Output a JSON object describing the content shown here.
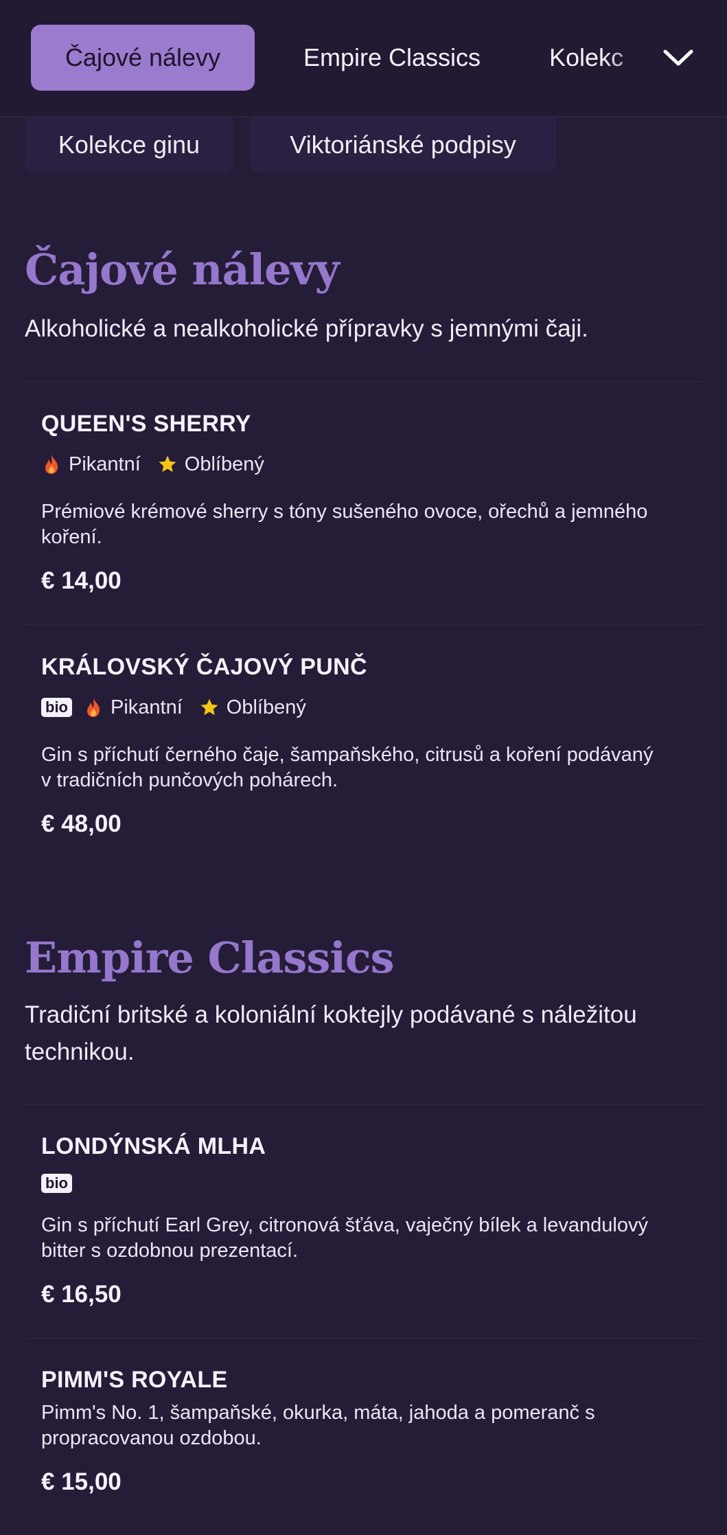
{
  "nav": {
    "tabs": [
      "Čajové nálevy",
      "Empire Classics",
      "Kolekce ginu"
    ],
    "tab_overflow_visible": "Kolekc",
    "row2": [
      "Kolekce ginu",
      "Viktoriánské podpisy"
    ],
    "active_color": "#9b7bce"
  },
  "sections": [
    {
      "title": "Čajové nálevy",
      "description": "Alkoholické a nealkoholické přípravky s jemnými čaji.",
      "items": [
        {
          "name": "QUEEN'S SHERRY",
          "tags": [
            "Pikantní",
            "Oblíbený"
          ],
          "description": "Prémiové krémové sherry s tóny sušeného ovoce, ořechů a jemného koření.",
          "price": "€ 14,00"
        },
        {
          "name": "KRÁLOVSKÝ ČAJOVÝ PUNČ",
          "badge": "bio",
          "tags": [
            "Pikantní",
            "Oblíbený"
          ],
          "description": "Gin s příchutí černého čaje, šampaňského, citrusů a koření podávaný v tradičních punčových pohárech.",
          "price": "€ 48,00"
        }
      ]
    },
    {
      "title": "Empire Classics",
      "description": "Tradiční britské a koloniální koktejly podávané s náležitou technikou.",
      "items": [
        {
          "name": "LONDÝNSKÁ MLHA",
          "badge": "bio",
          "description": "Gin s příchutí Earl Grey, citronová šťáva, vaječný bílek a levandulový bitter s ozdobnou prezentací.",
          "price": "€ 16,50"
        },
        {
          "name": "PIMM'S ROYALE",
          "description": "Pimm's No. 1, šampaňské, okurka, máta, jahoda a pomeranč s propracovanou ozdobou.",
          "price": "€ 15,00"
        }
      ]
    }
  ],
  "icons": {
    "spicy": "flame-icon",
    "favorite": "star-icon",
    "expand": "chevron-down-icon"
  },
  "colors": {
    "accent": "#9577cc",
    "background": "#251c38",
    "flame": "#f0582a",
    "star": "#f5c518"
  }
}
